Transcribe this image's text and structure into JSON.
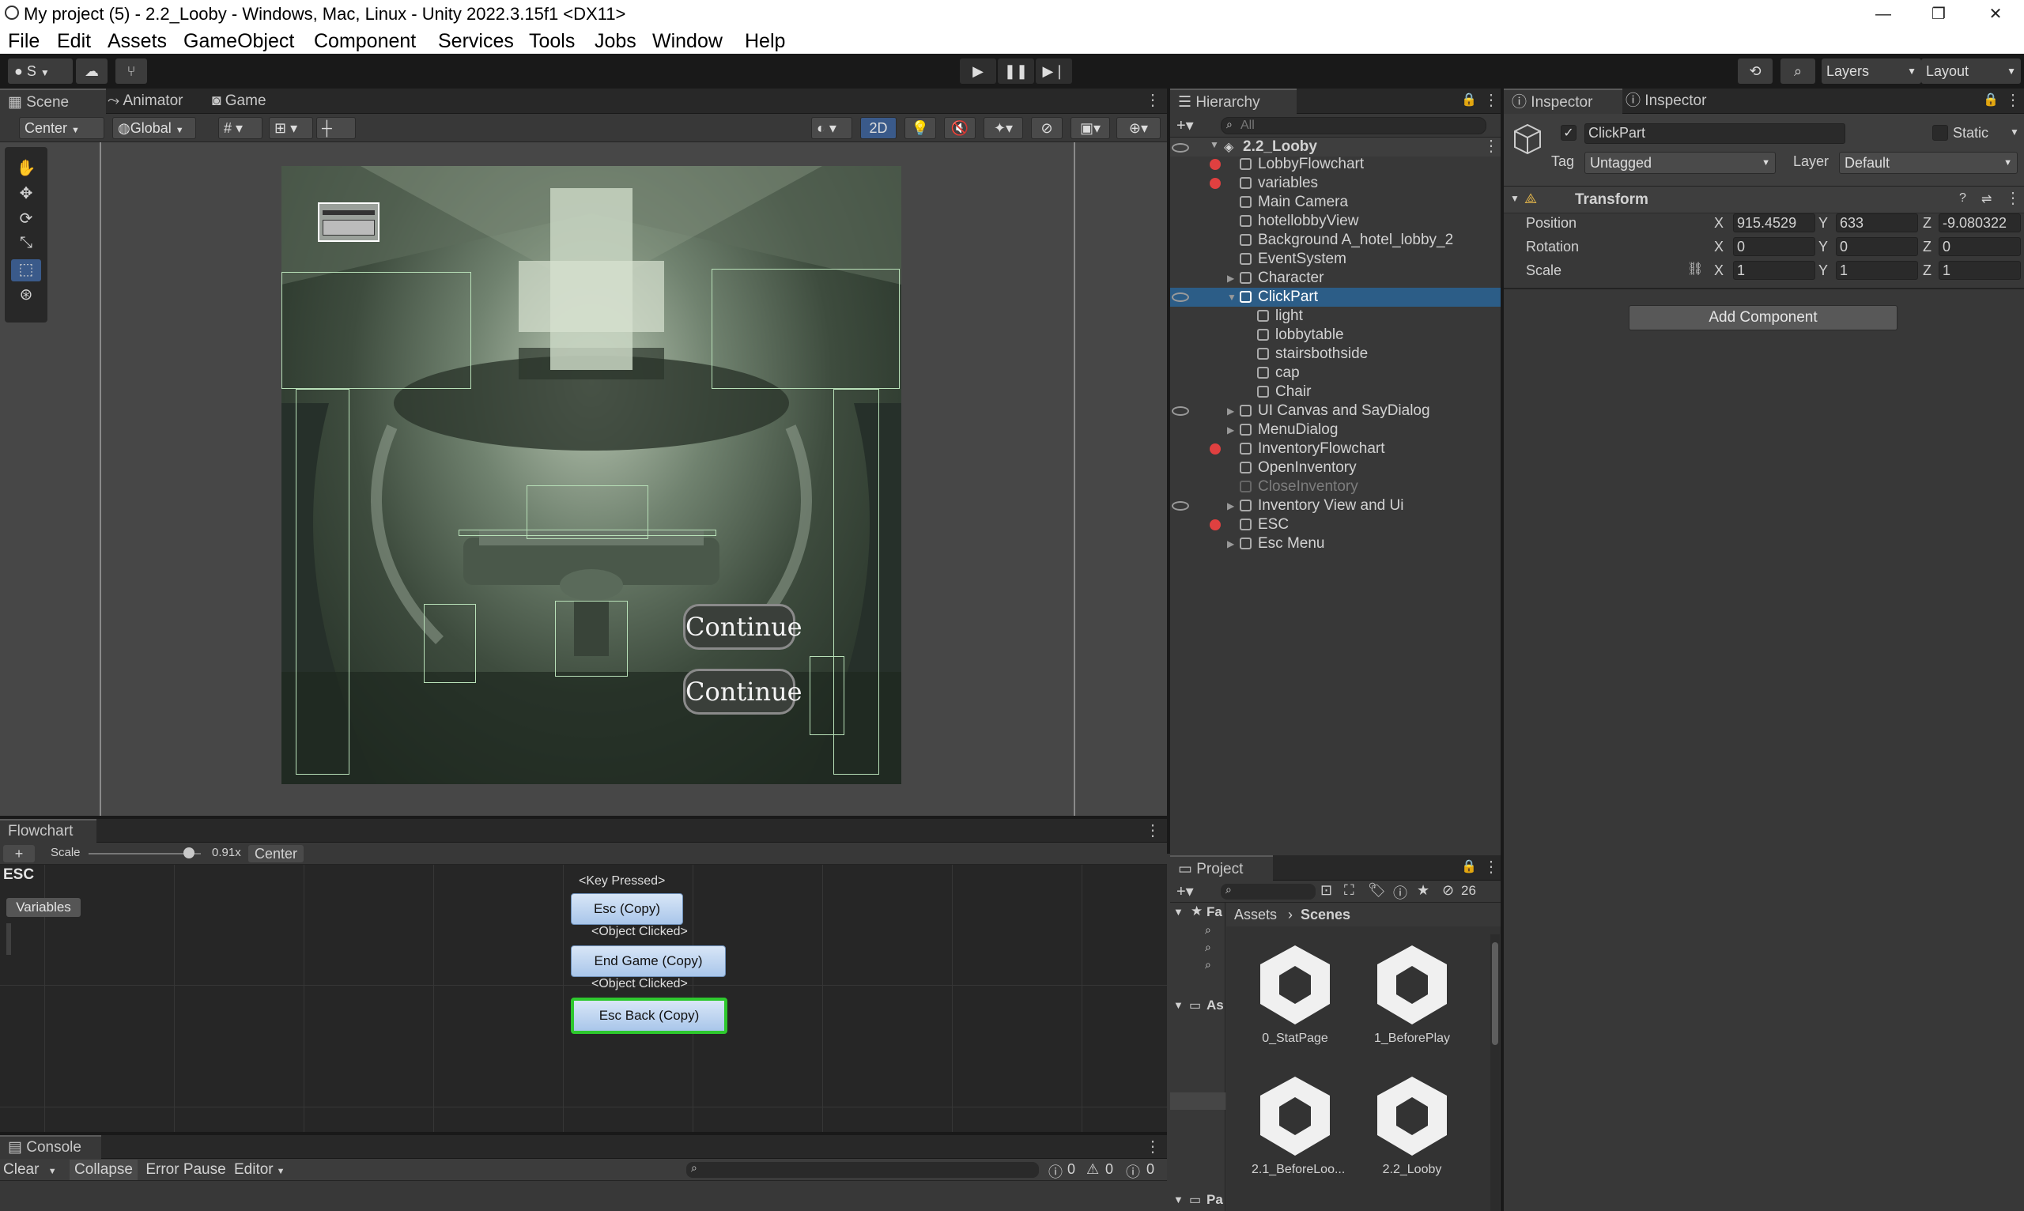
{
  "window": {
    "title": "My project (5) - 2.2_Looby - Windows, Mac, Linux - Unity 2022.3.15f1 <DX11>",
    "minimize": "—",
    "maximize": "❐",
    "close": "✕"
  },
  "menu": [
    "File",
    "Edit",
    "Assets",
    "GameObject",
    "Component",
    "Services",
    "Tools",
    "Jobs",
    "Window",
    "Help"
  ],
  "toolbar": {
    "account": "S",
    "layers": "Layers",
    "layout": "Layout"
  },
  "scene_panel": {
    "tabs": [
      "Scene",
      "Animator",
      "Game"
    ],
    "pivot": "Center",
    "space": "Global",
    "mode_2d": "2D",
    "continue_labels": [
      "Continue",
      "Continue"
    ]
  },
  "hierarchy": {
    "tab": "Hierarchy",
    "search_placeholder": "All",
    "scene": "2.2_Looby",
    "items": [
      {
        "label": "LobbyFlowchart"
      },
      {
        "label": "variables"
      },
      {
        "label": "Main Camera"
      },
      {
        "label": "hotellobbyView"
      },
      {
        "label": "Background A_hotel_lobby_2"
      },
      {
        "label": "EventSystem"
      },
      {
        "label": "Character"
      },
      {
        "label": "ClickPart"
      },
      {
        "label": "light"
      },
      {
        "label": "lobbytable"
      },
      {
        "label": "stairsbothside"
      },
      {
        "label": "cap"
      },
      {
        "label": "Chair"
      },
      {
        "label": "UI Canvas and SayDialog"
      },
      {
        "label": "MenuDialog"
      },
      {
        "label": "InventoryFlowchart"
      },
      {
        "label": "OpenInventory"
      },
      {
        "label": "CloseInventory"
      },
      {
        "label": "Inventory View and Ui"
      },
      {
        "label": "ESC"
      },
      {
        "label": "Esc Menu"
      }
    ]
  },
  "inspector": {
    "tabs": [
      "Inspector",
      "Inspector"
    ],
    "object_name": "ClickPart",
    "static_label": "Static",
    "tag_label": "Tag",
    "tag_value": "Untagged",
    "layer_label": "Layer",
    "layer_value": "Default",
    "component": "Transform",
    "position_label": "Position",
    "rotation_label": "Rotation",
    "scale_label": "Scale",
    "axis_x": "X",
    "axis_y": "Y",
    "axis_z": "Z",
    "position": {
      "x": "915.4529",
      "y": "633",
      "z": "-9.080322"
    },
    "rotation": {
      "x": "0",
      "y": "0",
      "z": "0"
    },
    "scale": {
      "x": "1",
      "y": "1",
      "z": "1"
    },
    "add_component": "Add Component"
  },
  "flowchart": {
    "tab": "Flowchart",
    "scale_label": "Scale",
    "scale_value": "0.91x",
    "center": "Center",
    "name": "ESC",
    "variables": "Variables",
    "blocks": [
      {
        "tag": "<Key Pressed>",
        "label": "Esc (Copy)"
      },
      {
        "tag": "<Object Clicked>",
        "label": "End Game (Copy)"
      },
      {
        "tag": "<Object Clicked>",
        "label": "Esc Back (Copy)"
      }
    ]
  },
  "project": {
    "tab": "Project",
    "breadcrumb_root": "Assets",
    "breadcrumb_current": "Scenes",
    "hidden_count": "26",
    "tree": {
      "favorites": "Fa",
      "assets": "As",
      "packages": "Pa"
    },
    "scenes": [
      "0_StatPage",
      "1_BeforePlay",
      "2.1_BeforeLoo...",
      "2.2_Looby"
    ]
  },
  "console": {
    "tab": "Console",
    "clear": "Clear",
    "collapse": "Collapse",
    "error_pause": "Error Pause",
    "editor": "Editor",
    "log_count": "0",
    "warn_count": "0",
    "error_count": "0"
  }
}
